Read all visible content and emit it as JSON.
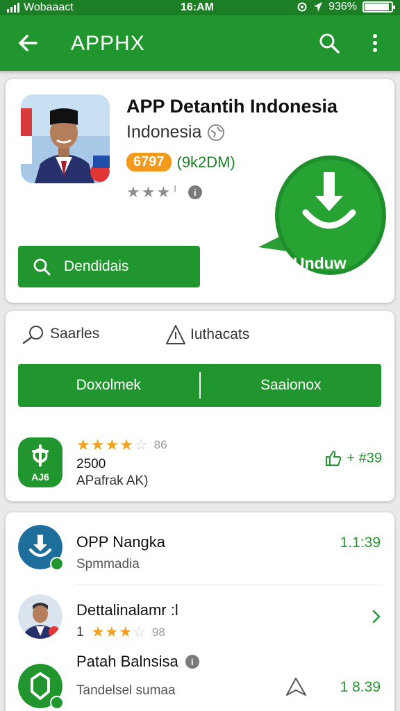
{
  "status_bar": {
    "carrier": "Wobaaact",
    "time": "16:AM",
    "battery": "936%",
    "battery_level": 0.93
  },
  "app_bar": {
    "title": "APPHX"
  },
  "app_detail": {
    "name": "APP Detantih Indonesia",
    "publisher": "Indonesia",
    "price": "6797",
    "price_sub": "(9k2DM)",
    "rating": 3.5,
    "search_button_label": "Dendidais",
    "download_label": "Unduw"
  },
  "section": {
    "tab_left": "Saarles",
    "tab_right": "Iuthacats",
    "segment_left": "Doxolmek",
    "segment_right": "Saaionox",
    "listing": {
      "icon_text": "AJ6",
      "rating_count": "86",
      "size": "2500",
      "developer": "APafrak AK)",
      "action_text": "+ #39"
    }
  },
  "list": [
    {
      "title": "OPP Nangka",
      "subtitle": "Spmmadia",
      "time": "1.1:39"
    },
    {
      "title": "Dettalinalamr :l",
      "lead": "1",
      "rating_count": "98"
    },
    {
      "title": "Patah Balnsisa",
      "subtitle": "Tandelsel sumaa",
      "time": "1 8.39"
    }
  ],
  "colors": {
    "brand_green": "#22962e",
    "status_green": "#1d7f25",
    "star_orange": "#f2a01f"
  }
}
